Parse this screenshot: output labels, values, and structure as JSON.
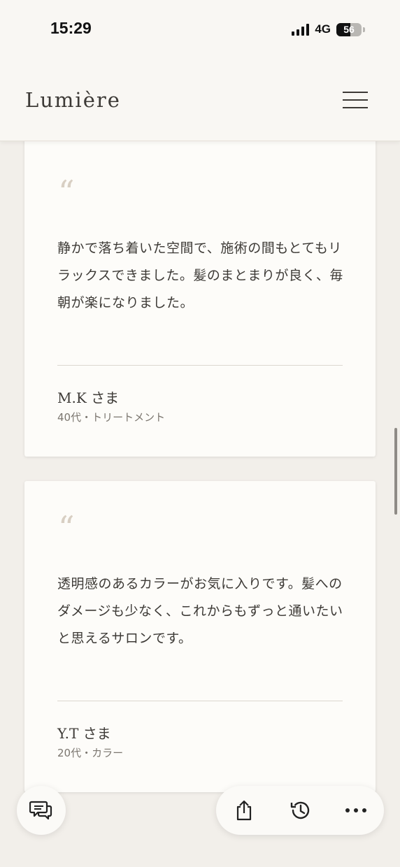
{
  "status_bar": {
    "time": "15:29",
    "network": "4G",
    "battery_percent": "56",
    "battery_level": 0.56
  },
  "header": {
    "brand": "Lumière",
    "menu_icon": "hamburger-menu-icon"
  },
  "reviews": [
    {
      "quote_mark": "“",
      "text": "静かで落ち着いた空間で、施術の間もとてもリラックスできました。髪のまとまりが良く、毎朝が楽になりました。",
      "name": "M.K さま",
      "detail": "40代・トリートメント"
    },
    {
      "quote_mark": "“",
      "text": "透明感のあるカラーがお気に入りです。髪へのダメージも少なく、これからもずっと通いたいと思えるサロンです。",
      "name": "Y.T さま",
      "detail": "20代・カラー"
    }
  ],
  "toolbar": {
    "chat_icon": "chat-bubbles-icon",
    "share_icon": "share-icon",
    "history_icon": "history-icon",
    "more_icon": "more-icon"
  },
  "colors": {
    "background": "#f2efea",
    "card": "#fdfcf9",
    "text": "#3d3a36",
    "muted": "#7b766f",
    "quote_mark": "#d8cfc3"
  }
}
